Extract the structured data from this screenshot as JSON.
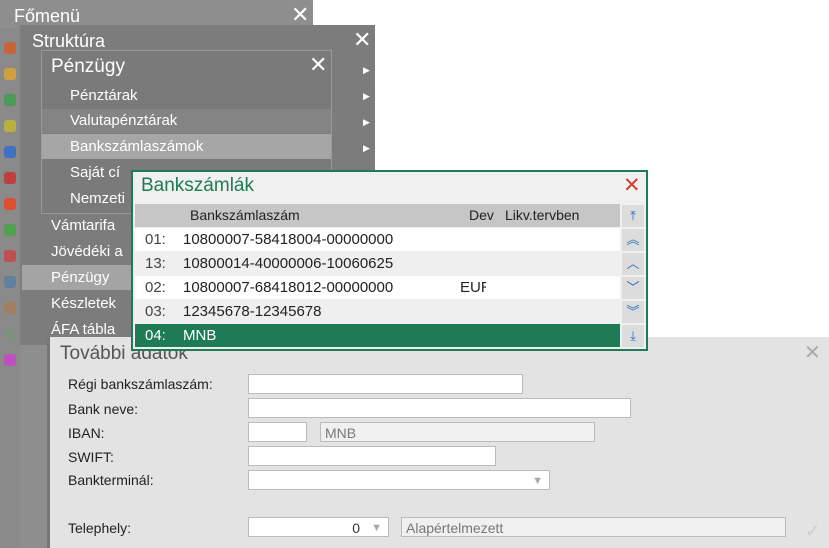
{
  "fomenu": {
    "title": "Főmenü",
    "strip_icons": [
      "#c8643c",
      "#d0a040",
      "#4a9a5a",
      "#b8b040",
      "#4070c0",
      "#c04040",
      "#e05030",
      "#50a050",
      "#c05050",
      "#6080a0",
      "#a08060",
      "#809080",
      "#c050c0"
    ]
  },
  "struktura": {
    "title": "Struktúra",
    "items": [
      {
        "label": "Vámtarifa"
      },
      {
        "label": "Jövédéki a"
      },
      {
        "label": "Pénzügy"
      },
      {
        "label": "Készletek"
      },
      {
        "label": "ÁFA tábla"
      }
    ]
  },
  "penzugy": {
    "title": "Pénzügy",
    "items": [
      {
        "label": "Pénztárak"
      },
      {
        "label": "Valutapénztárak"
      },
      {
        "label": "Bankszámlaszámok"
      },
      {
        "label": "Saját cí"
      },
      {
        "label": "Nemzeti"
      }
    ]
  },
  "bankszamlak": {
    "title": "Bankszámlák",
    "columns": {
      "account": "Bankszámlaszám",
      "dev": "Dev",
      "likv": "Likv.tervben"
    },
    "rows": [
      {
        "n": "01:",
        "account": "10800007-58418004-00000000",
        "dev": ""
      },
      {
        "n": "13:",
        "account": "10800014-40000006-10060625",
        "dev": ""
      },
      {
        "n": "02:",
        "account": "10800007-68418012-00000000",
        "dev": "EUR"
      },
      {
        "n": "03:",
        "account": "12345678-12345678",
        "dev": ""
      },
      {
        "n": "04:",
        "account": "MNB",
        "dev": ""
      }
    ],
    "nav": [
      "⤒",
      "︽",
      "︿",
      "﹀",
      "︾",
      "⤓"
    ],
    "accent": "#1e7b56"
  },
  "tovabbi": {
    "title": "További adatok",
    "regi_label": "Régi bankszámlaszám:",
    "bank_neve_label": "Bank neve:",
    "iban_label": "IBAN:",
    "iban_name": "MNB",
    "swift_label": "SWIFT:",
    "bankterminal_label": "Bankterminál:",
    "telephely_label": "Telephely:",
    "telephely_value": "0",
    "telephely_name": "Alapértelmezett"
  }
}
